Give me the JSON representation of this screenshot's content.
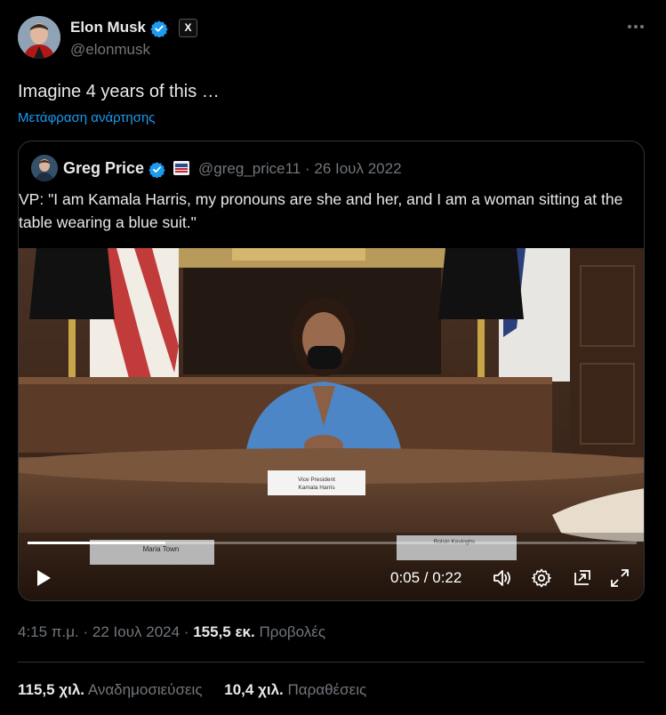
{
  "author": {
    "name": "Elon Musk",
    "handle": "@elonmusk",
    "affiliate_badge": "X",
    "verified_color": "#1d9bf0"
  },
  "more_icon": "more-horizontal-icon",
  "tweet": {
    "text": "Imagine 4 years of this …",
    "translate_label": "Μετάφραση ανάρτησης"
  },
  "quoted": {
    "name": "Greg Price",
    "handle": "@greg_price11",
    "separator": "·",
    "date": "26 Ιουλ 2022",
    "text": "VP: \"I am Kamala Harris, my pronouns are she and her, and I am a woman sitting at the table wearing a blue suit.\"",
    "video": {
      "current_time": "0:05",
      "duration": "0:22",
      "time_display": "0:05 / 0:22",
      "progress": 0.227,
      "placards": [
        "Vice President Kamala Harris",
        "Maria Town",
        "Rolsin Kevinghs"
      ]
    }
  },
  "meta": {
    "time": "4:15 π.μ.",
    "sep1": "·",
    "date": "22 Ιουλ 2024",
    "sep2": "·",
    "views_count": "155,5 εκ.",
    "views_label": "Προβολές"
  },
  "stats": {
    "reposts_count": "115,5 χιλ.",
    "reposts_label": "Αναδημοσιεύσεις",
    "quotes_count": "10,4 χιλ.",
    "quotes_label": "Παραθέσεις"
  }
}
